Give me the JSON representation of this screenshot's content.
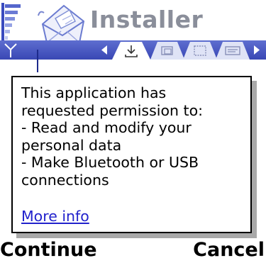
{
  "header": {
    "title": "Installer",
    "signal_icon": "signal-strength-icon",
    "app_icon": "installer-envelope-icon",
    "antenna_icon": "antenna-icon"
  },
  "tabs": {
    "items": [
      {
        "icon": "install-package-icon",
        "active": true
      },
      {
        "icon": "folder-icon",
        "active": false
      },
      {
        "icon": "package-icon",
        "active": false
      },
      {
        "icon": "package-list-icon",
        "active": false
      }
    ],
    "left_arrow_icon": "arrow-left-icon",
    "right_arrow_icon": "arrow-right-icon"
  },
  "dialog": {
    "lines": [
      "This application has",
      "requested permission to:",
      " - Read and modify your",
      "personal data",
      " - Make Bluetooth or USB",
      "connections"
    ],
    "link": "More info"
  },
  "softkeys": {
    "left": "Continue",
    "right": "Cancel"
  },
  "colors": {
    "tab_bar": "#4656c4",
    "title": "#8a8e9a",
    "link": "#2222cc",
    "dialog_shadow": "#a9a9a9"
  }
}
